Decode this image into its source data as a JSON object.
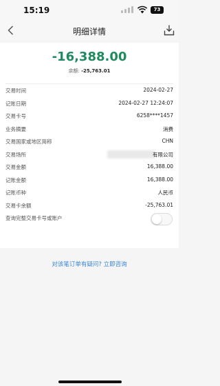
{
  "status_bar": {
    "time": "15:19",
    "battery": "73",
    "icons": [
      "signal-icon",
      "wifi-icon",
      "battery-icon"
    ]
  },
  "nav": {
    "title": "明细详情",
    "back_icon": "back-chevron-icon",
    "download_icon": "download-icon"
  },
  "transaction": {
    "amount": "-16,388.00",
    "amount_color": "#1f8a5f",
    "balance_label": "余额:",
    "balance_value": "-25,763.01"
  },
  "details": [
    {
      "label": "交易时间",
      "value": "2024-02-27"
    },
    {
      "label": "记账日期",
      "value": "2024-02-27 12:24:07"
    },
    {
      "label": "交易卡号",
      "value": "6258****1457"
    },
    {
      "label": "业务摘要",
      "value": "消费"
    },
    {
      "label": "交易国家或地区简称",
      "value": "CHN"
    },
    {
      "label": "交易场所",
      "value": "有限公司"
    },
    {
      "label": "交易金额",
      "value": "16,388.00"
    },
    {
      "label": "记账金额",
      "value": "16,388.00"
    },
    {
      "label": "记账币种",
      "value": "人民币"
    },
    {
      "label": "交易卡余额",
      "value": "-25,763.01"
    }
  ],
  "toggle": {
    "label": "查询完整交易卡号或账户",
    "on": false
  },
  "help_link": "对该笔订单有疑问? 立即咨询",
  "colors": {
    "accent_green": "#1f8a5f",
    "link_blue": "#3a85d6",
    "background": "#f5f5f5"
  }
}
